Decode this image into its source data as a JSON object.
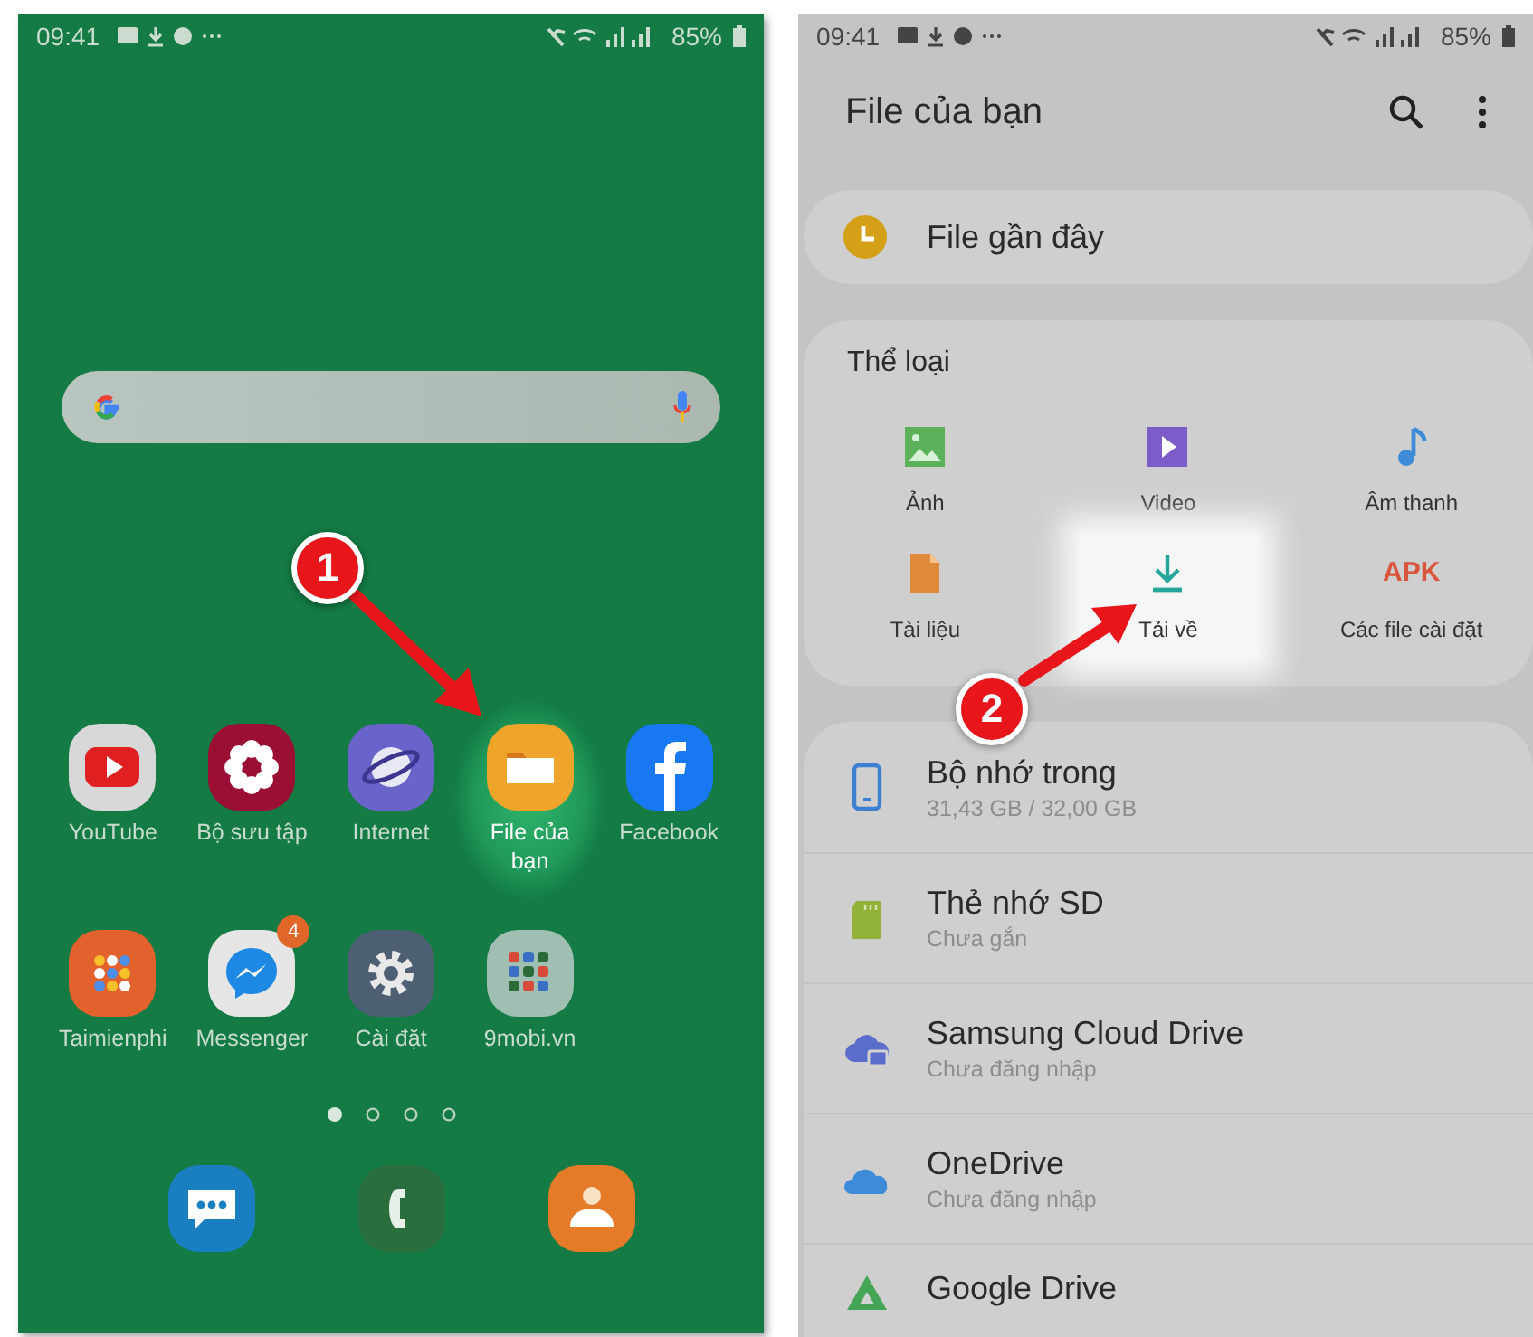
{
  "home_screen": {
    "status_bar": {
      "time": "09:41",
      "battery": "85%"
    },
    "apps": [
      {
        "label": "YouTube",
        "kind": "youtube",
        "highlighted": false
      },
      {
        "label": "Bộ sưu tập",
        "kind": "gallery",
        "highlighted": false
      },
      {
        "label": "Internet",
        "kind": "internet",
        "highlighted": false
      },
      {
        "label": "File của bạn",
        "kind": "files",
        "highlighted": true
      },
      {
        "label": "Facebook",
        "kind": "facebook",
        "highlighted": false
      },
      {
        "label": "Taimienphi",
        "kind": "appfolder",
        "highlighted": false
      },
      {
        "label": "Messenger",
        "kind": "messenger",
        "highlighted": false,
        "badge": "4"
      },
      {
        "label": "Cài đặt",
        "kind": "settings",
        "highlighted": false
      },
      {
        "label": "9mobi.vn",
        "kind": "folder",
        "highlighted": false
      }
    ],
    "page_dots": [
      {
        "selected": true
      },
      {
        "selected": false
      },
      {
        "selected": false
      },
      {
        "selected": false
      }
    ],
    "dock": [
      {
        "kind": "messages"
      },
      {
        "kind": "phone"
      },
      {
        "kind": "contacts"
      }
    ]
  },
  "files_screen": {
    "status_bar": {
      "time": "09:41",
      "battery": "85%"
    },
    "title": "File của bạn",
    "recent": "File gần đây",
    "categories_title": "Thể loại",
    "categories": [
      {
        "label": "Ảnh",
        "kind": "image",
        "highlighted": false
      },
      {
        "label": "Video",
        "kind": "video",
        "highlighted": false
      },
      {
        "label": "Âm thanh",
        "kind": "audio",
        "highlighted": false
      },
      {
        "label": "Tài liệu",
        "kind": "document",
        "highlighted": false
      },
      {
        "label": "Tải về",
        "kind": "download",
        "highlighted": true
      },
      {
        "label": "Các file cài đặt",
        "kind": "apk",
        "icon_text": "APK",
        "highlighted": false
      }
    ],
    "storage": [
      {
        "title": "Bộ nhớ trong",
        "subtitle": "31,43 GB / 32,00 GB",
        "kind": "internal"
      },
      {
        "title": "Thẻ nhớ SD",
        "subtitle": "Chưa gắn",
        "kind": "sd"
      },
      {
        "title": "Samsung Cloud Drive",
        "subtitle": "Chưa đăng nhập",
        "kind": "samsung"
      },
      {
        "title": "OneDrive",
        "subtitle": "Chưa đăng nhập",
        "kind": "onedrive"
      },
      {
        "title": "Google Drive",
        "kind": "gdrive"
      }
    ]
  },
  "annotations": [
    {
      "number": "1"
    },
    {
      "number": "2"
    }
  ]
}
